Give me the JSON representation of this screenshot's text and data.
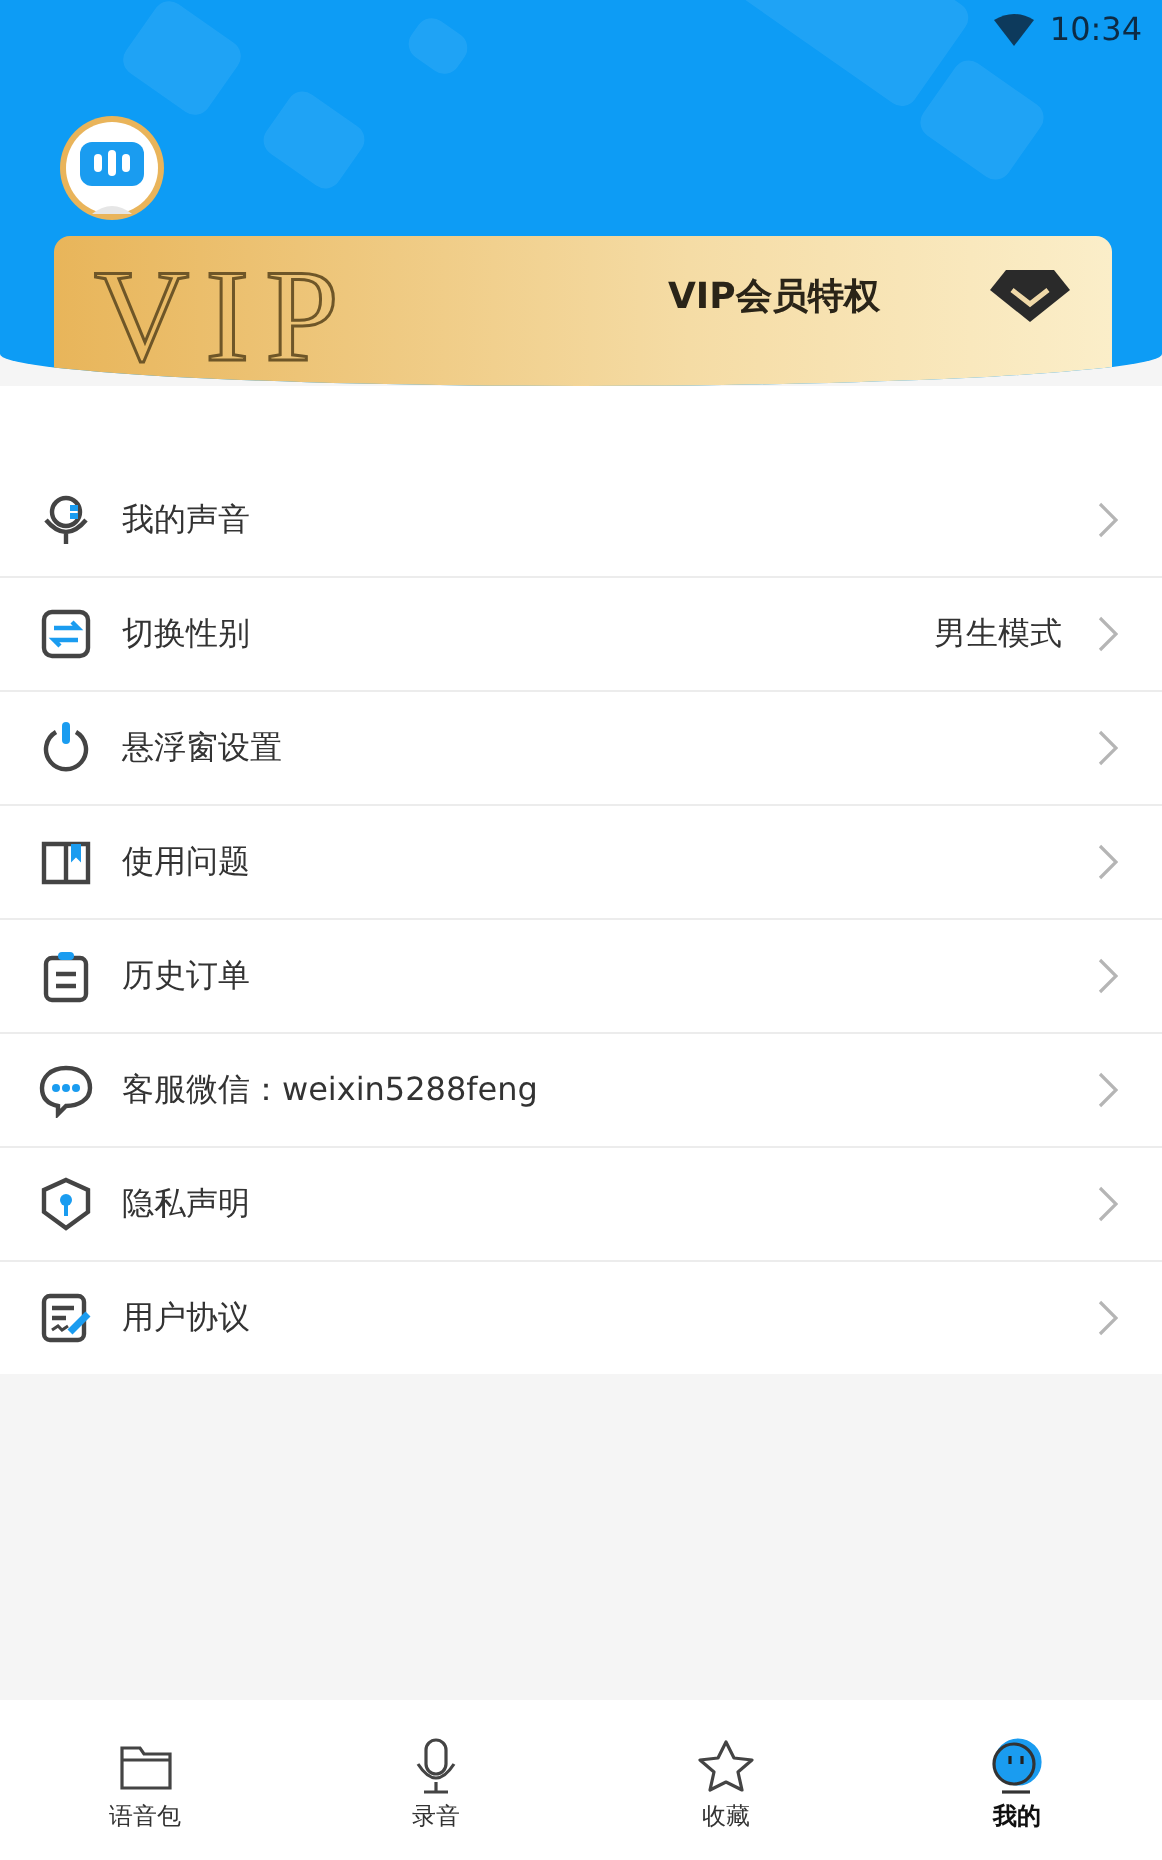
{
  "status_bar": {
    "time": "10:34"
  },
  "vip_card": {
    "badge": "VIP",
    "title": "VIP会员特权"
  },
  "menu": [
    {
      "label": "我的声音"
    },
    {
      "label": "切换性别",
      "value": "男生模式"
    },
    {
      "label": "悬浮窗设置"
    },
    {
      "label": "使用问题"
    },
    {
      "label": "历史订单"
    },
    {
      "label": "客服微信：weixin5288feng"
    },
    {
      "label": "隐私声明"
    },
    {
      "label": "用户协议"
    }
  ],
  "tabs": [
    {
      "label": "语音包",
      "selected": false
    },
    {
      "label": "录音",
      "selected": false
    },
    {
      "label": "收藏",
      "selected": false
    },
    {
      "label": "我的",
      "selected": true
    }
  ]
}
